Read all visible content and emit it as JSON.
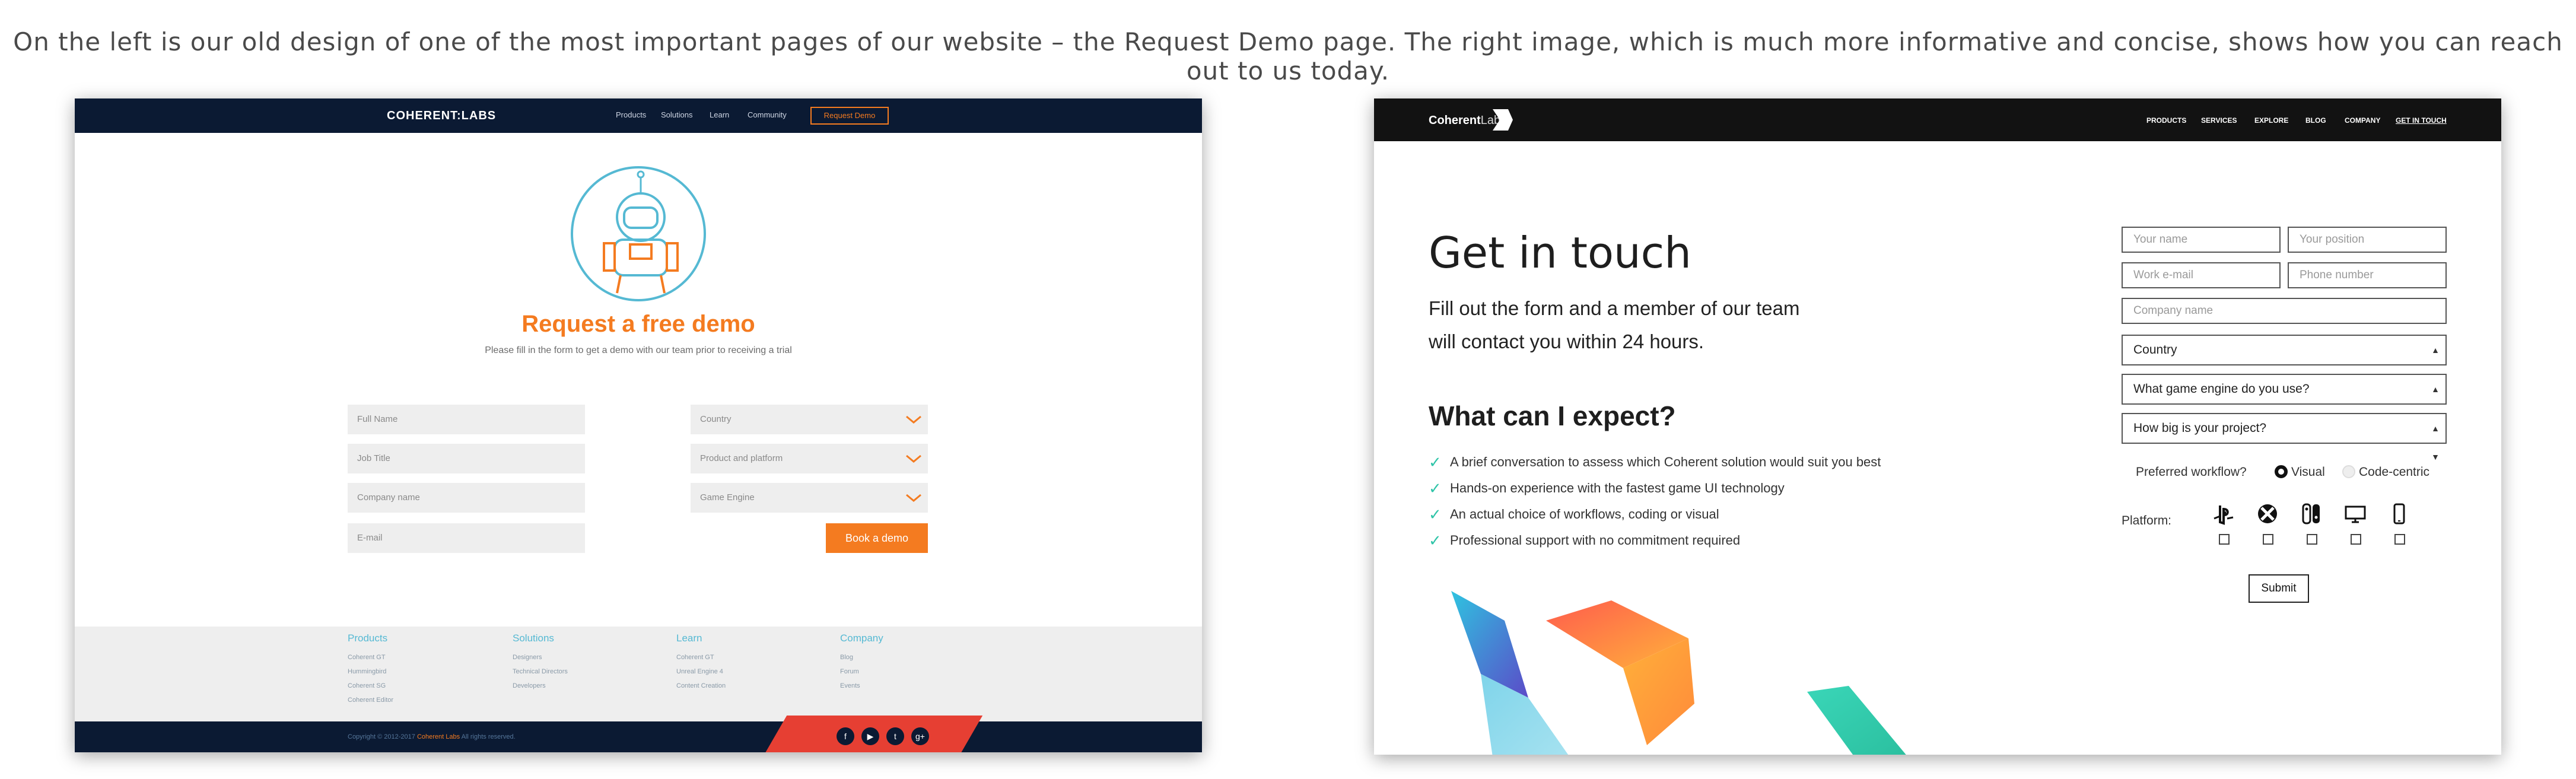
{
  "caption": "On the left is our old design of one of the most important pages of our website – the Request Demo page. The right image, which is much more informative and concise, shows how you can reach out to us today.",
  "old_design": {
    "logo": "COHERENT:LABS",
    "nav": [
      "Products",
      "Solutions",
      "Learn",
      "Community"
    ],
    "nav_cta": "Request Demo",
    "title": "Request a free demo",
    "subtitle": "Please fill in the form to get a demo with our team prior to receiving a trial",
    "fields_left": [
      "Full Name",
      "Job Title",
      "Company name",
      "E-mail"
    ],
    "fields_right": [
      "Country",
      "Product and platform",
      "Game Engine"
    ],
    "book_button": "Book a demo",
    "footer": {
      "columns": [
        {
          "title": "Products",
          "links": [
            "Coherent GT",
            "Hummingbird",
            "Coherent SG",
            "Coherent Editor"
          ]
        },
        {
          "title": "Solutions",
          "links": [
            "Designers",
            "Technical Directors",
            "Developers"
          ]
        },
        {
          "title": "Learn",
          "links": [
            "Coherent GT",
            "Unreal Engine 4",
            "Content Creation"
          ]
        },
        {
          "title": "Company",
          "links": [
            "Blog",
            "Forum",
            "Events"
          ]
        }
      ],
      "copyright_pre": "Copyright © 2012-2017",
      "copyright_brand": "Coherent Labs",
      "copyright_post": "All rights reserved.",
      "social": [
        "f",
        "▶",
        "t",
        "g+"
      ]
    },
    "colors": {
      "nav": "#0b1a33",
      "accent": "#f47b20",
      "teal": "#55b9d3"
    }
  },
  "new_design": {
    "logo_bold": "Coherent",
    "logo_light": "Labs",
    "nav": [
      "PRODUCTS",
      "SERVICES",
      "EXPLORE",
      "BLOG",
      "COMPANY",
      "GET IN TOUCH"
    ],
    "heading": "Get in touch",
    "intro_line1": "Fill out the form and a member of our team",
    "intro_line2": "will contact you within 24 hours.",
    "expect_heading": "What can I expect?",
    "expect_items": [
      "A brief conversation to assess which Coherent solution would suit you best",
      "Hands-on experience with the fastest game UI technology",
      "An actual choice of workflows, coding or visual",
      "Professional support with no commitment required"
    ],
    "form": {
      "your_name": "Your name",
      "your_position": "Your position",
      "work_email": "Work e-mail",
      "phone": "Phone number",
      "company": "Company name",
      "country": "Country",
      "engine": "What game engine do you use?",
      "project": "How big is your project?",
      "workflow_label": "Preferred workflow?",
      "workflow_visual": "Visual",
      "workflow_code": "Code-centric",
      "platform_label": "Platform:",
      "platform_icons": [
        "playstation-icon",
        "xbox-icon",
        "switch-icon",
        "desktop-icon",
        "mobile-icon"
      ],
      "submit": "Submit"
    },
    "colors": {
      "nav": "#121212",
      "check": "#2fc4a8"
    }
  }
}
